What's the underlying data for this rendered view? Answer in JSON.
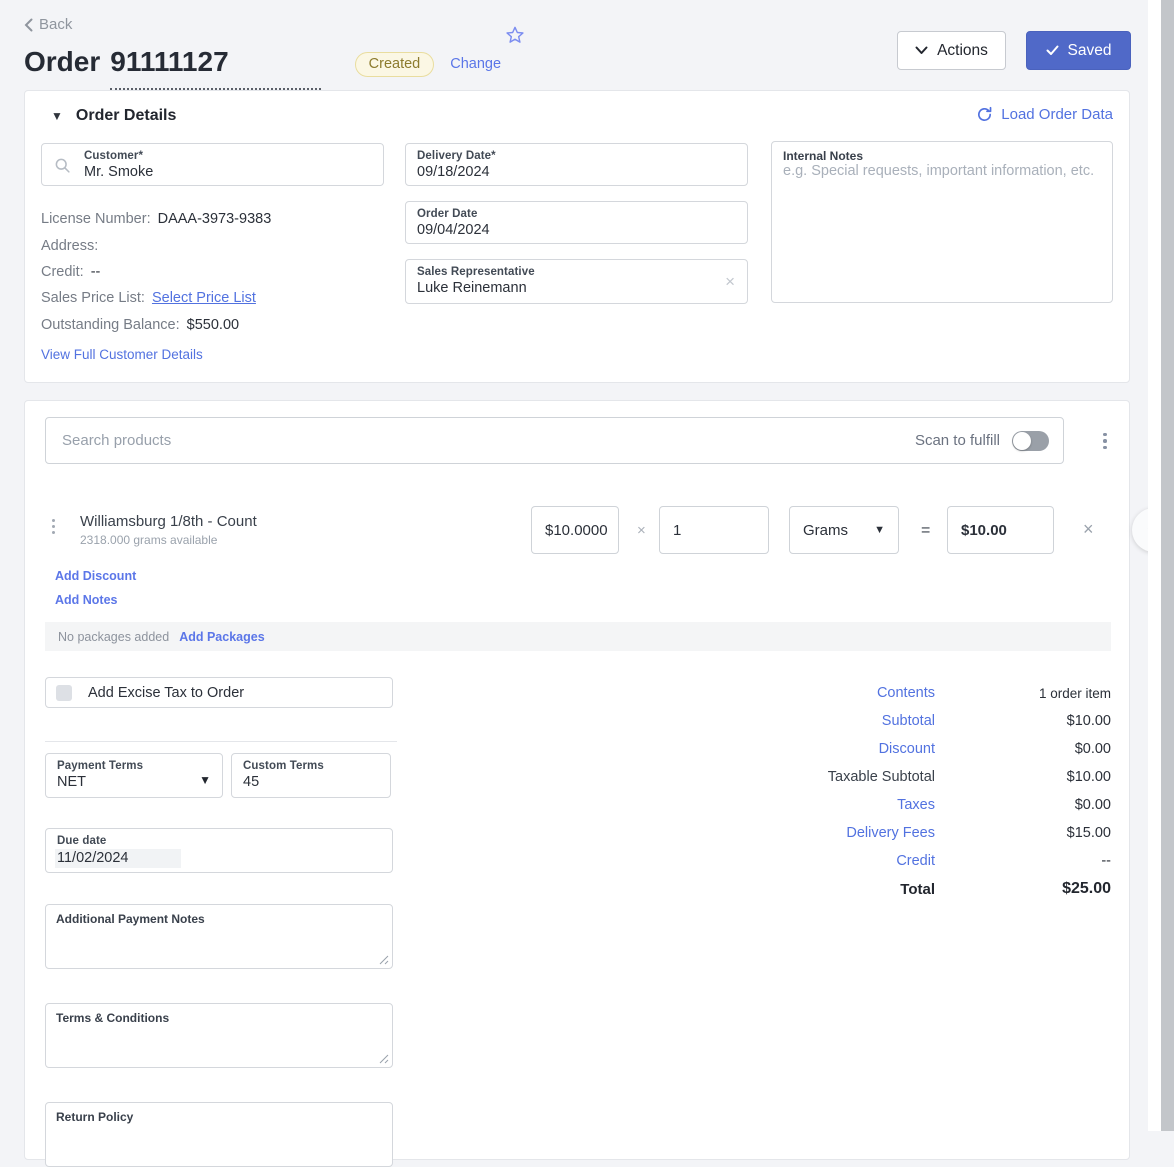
{
  "colors": {
    "accent_link": "#5272e0",
    "saved_button": "#5069c8",
    "badge_bg": "#fbf7e4",
    "badge_text": "#8c7b2e"
  },
  "header": {
    "back_label": "Back",
    "title_prefix": "Order",
    "order_number": "91111127",
    "status_badge": "Created",
    "change_label": "Change",
    "actions_label": "Actions",
    "saved_label": "Saved"
  },
  "order_details": {
    "section_title": "Order Details",
    "load_order_data_label": "Load Order Data",
    "customer": {
      "label": "Customer*",
      "value": "Mr. Smoke"
    },
    "info": {
      "license_label": "License Number:",
      "license_value": "DAAA-3973-9383",
      "address_label": "Address:",
      "address_value": "",
      "credit_label": "Credit:",
      "credit_value": "--",
      "price_list_label": "Sales Price List:",
      "price_list_link": "Select Price List",
      "balance_label": "Outstanding Balance:",
      "balance_value": "$550.00",
      "view_details_link": "View Full Customer Details"
    },
    "delivery_date": {
      "label": "Delivery Date*",
      "value": "09/18/2024"
    },
    "order_date": {
      "label": "Order Date",
      "value": "09/04/2024"
    },
    "sales_rep": {
      "label": "Sales Representative",
      "value": "Luke Reinemann"
    },
    "internal_notes": {
      "label": "Internal Notes",
      "placeholder": "e.g. Special requests, important information, etc."
    }
  },
  "products": {
    "search_placeholder": "Search products",
    "scan_label": "Scan to fulfill",
    "line_item": {
      "name": "Williamsburg 1/8th - Count",
      "availability": "2318.000 grams available",
      "unit_price": "$10.0000",
      "multiply_sign": "×",
      "quantity": "1",
      "unit": "Grams",
      "equals_sign": "=",
      "total": "$10.00",
      "add_discount_label": "Add Discount",
      "add_notes_label": "Add Notes"
    },
    "packages": {
      "empty_text": "No packages added",
      "add_label": "Add Packages"
    }
  },
  "payment": {
    "excise_label": "Add Excise Tax to Order",
    "terms": {
      "label": "Payment Terms",
      "value": "NET"
    },
    "custom_terms": {
      "label": "Custom Terms",
      "value": "45"
    },
    "due_date": {
      "label": "Due date",
      "value": "11/02/2024"
    },
    "additional_notes_label": "Additional Payment Notes",
    "terms_conditions_label": "Terms & Conditions",
    "return_policy_label": "Return Policy"
  },
  "summary": {
    "rows": [
      {
        "label": "Contents",
        "value": "1 order item"
      },
      {
        "label": "Subtotal",
        "value": "$10.00"
      },
      {
        "label": "Discount",
        "value": "$0.00"
      },
      {
        "label": "Taxable Subtotal",
        "value": "$10.00"
      },
      {
        "label": "Taxes",
        "value": "$0.00"
      },
      {
        "label": "Delivery Fees",
        "value": "$15.00"
      },
      {
        "label": "Credit",
        "value": "--"
      },
      {
        "label": "Total",
        "value": "$25.00"
      }
    ]
  }
}
